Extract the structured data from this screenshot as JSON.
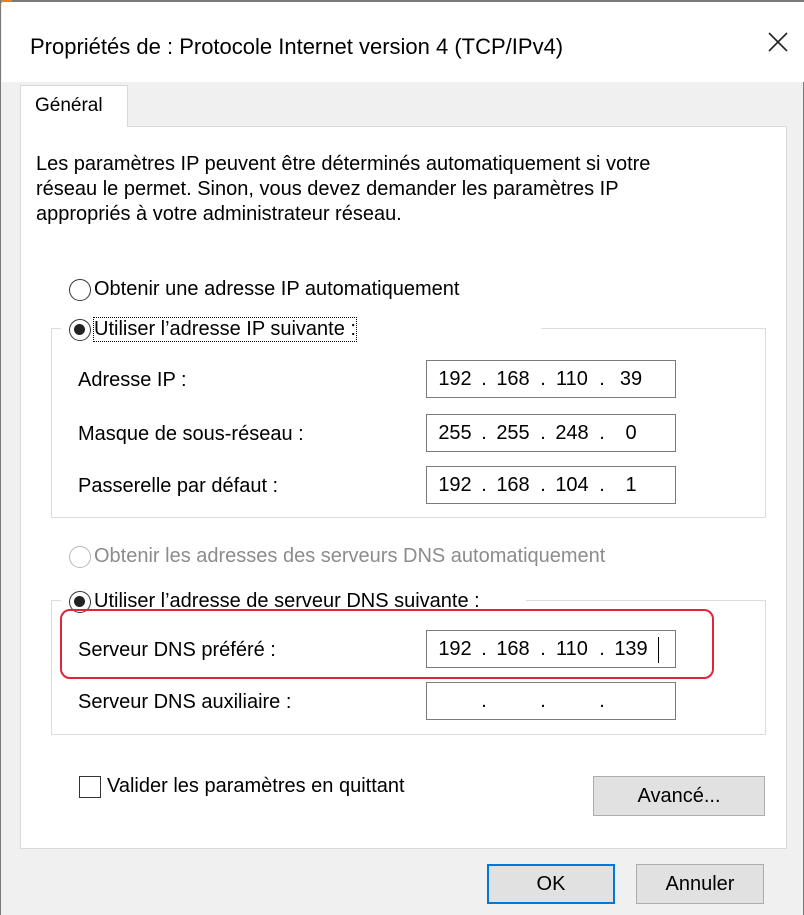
{
  "window": {
    "title": "Propriétés de : Protocole Internet version 4 (TCP/IPv4)",
    "close_icon": "close-icon"
  },
  "tabs": [
    {
      "label": "Général",
      "active": true
    }
  ],
  "intro": {
    "lines": [
      "Les paramètres IP peuvent être déterminés automatiquement si votre",
      "réseau le permet. Sinon, vous devez demander les paramètres IP",
      "appropriés à votre administrateur réseau."
    ]
  },
  "ip_section": {
    "auto_label": "Obtenir une adresse IP automatiquement",
    "manual_label": "Utiliser l’adresse IP suivante :",
    "selected": "manual",
    "fields": [
      {
        "label": "Adresse IP :",
        "octets": [
          "192",
          "168",
          "110",
          "39"
        ]
      },
      {
        "label": "Masque de sous-réseau :",
        "octets": [
          "255",
          "255",
          "248",
          "0"
        ]
      },
      {
        "label": "Passerelle par défaut :",
        "octets": [
          "192",
          "168",
          "104",
          "1"
        ]
      }
    ]
  },
  "dns_section": {
    "auto_label": "Obtenir les adresses des serveurs DNS automatiquement",
    "auto_enabled": false,
    "manual_label": "Utiliser l’adresse de serveur DNS suivante :",
    "selected": "manual",
    "fields": [
      {
        "label": "Serveur DNS préféré :",
        "octets": [
          "192",
          "168",
          "110",
          "139"
        ],
        "highlighted": true
      },
      {
        "label": "Serveur DNS auxiliaire :",
        "octets": [
          "",
          "",
          "",
          ""
        ]
      }
    ]
  },
  "validate_checkbox": {
    "label": "Valider les paramètres en quittant",
    "checked": false
  },
  "buttons": {
    "advanced": "Avancé...",
    "ok": "OK",
    "cancel": "Annuler"
  },
  "colors": {
    "highlight": "#e0243a",
    "default_button_border": "#0078d7",
    "disabled_text": "#8c8c8c"
  }
}
